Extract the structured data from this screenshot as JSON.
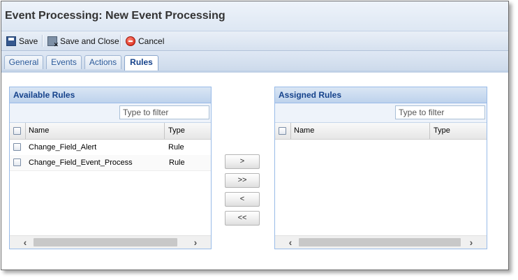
{
  "window": {
    "title": "Event Processing: New Event Processing"
  },
  "toolbar": {
    "save_label": "Save",
    "save_close_label": "Save and Close",
    "cancel_label": "Cancel",
    "icons": {
      "save": "save-icon",
      "save_close": "save-and-close-icon",
      "cancel": "cancel-icon"
    }
  },
  "tabs": [
    {
      "label": "General"
    },
    {
      "label": "Events"
    },
    {
      "label": "Actions"
    },
    {
      "label": "Rules",
      "active": true
    }
  ],
  "available": {
    "title": "Available Rules",
    "filter_placeholder": "Type to filter",
    "columns": {
      "name": "Name",
      "type": "Type"
    },
    "rows": [
      {
        "name": "Change_Field_Alert",
        "type": "Rule"
      },
      {
        "name": "Change_Field_Event_Process",
        "type": "Rule"
      }
    ]
  },
  "assigned": {
    "title": "Assigned Rules",
    "filter_placeholder": "Type to filter",
    "columns": {
      "name": "Name",
      "type": "Type"
    },
    "rows": []
  },
  "move_buttons": {
    "add": ">",
    "add_all": ">>",
    "remove": "<",
    "remove_all": "<<"
  },
  "colors": {
    "panel_header_text": "#15428b",
    "panel_border": "#99bbe8",
    "tab_text": "#2b5a9a"
  }
}
